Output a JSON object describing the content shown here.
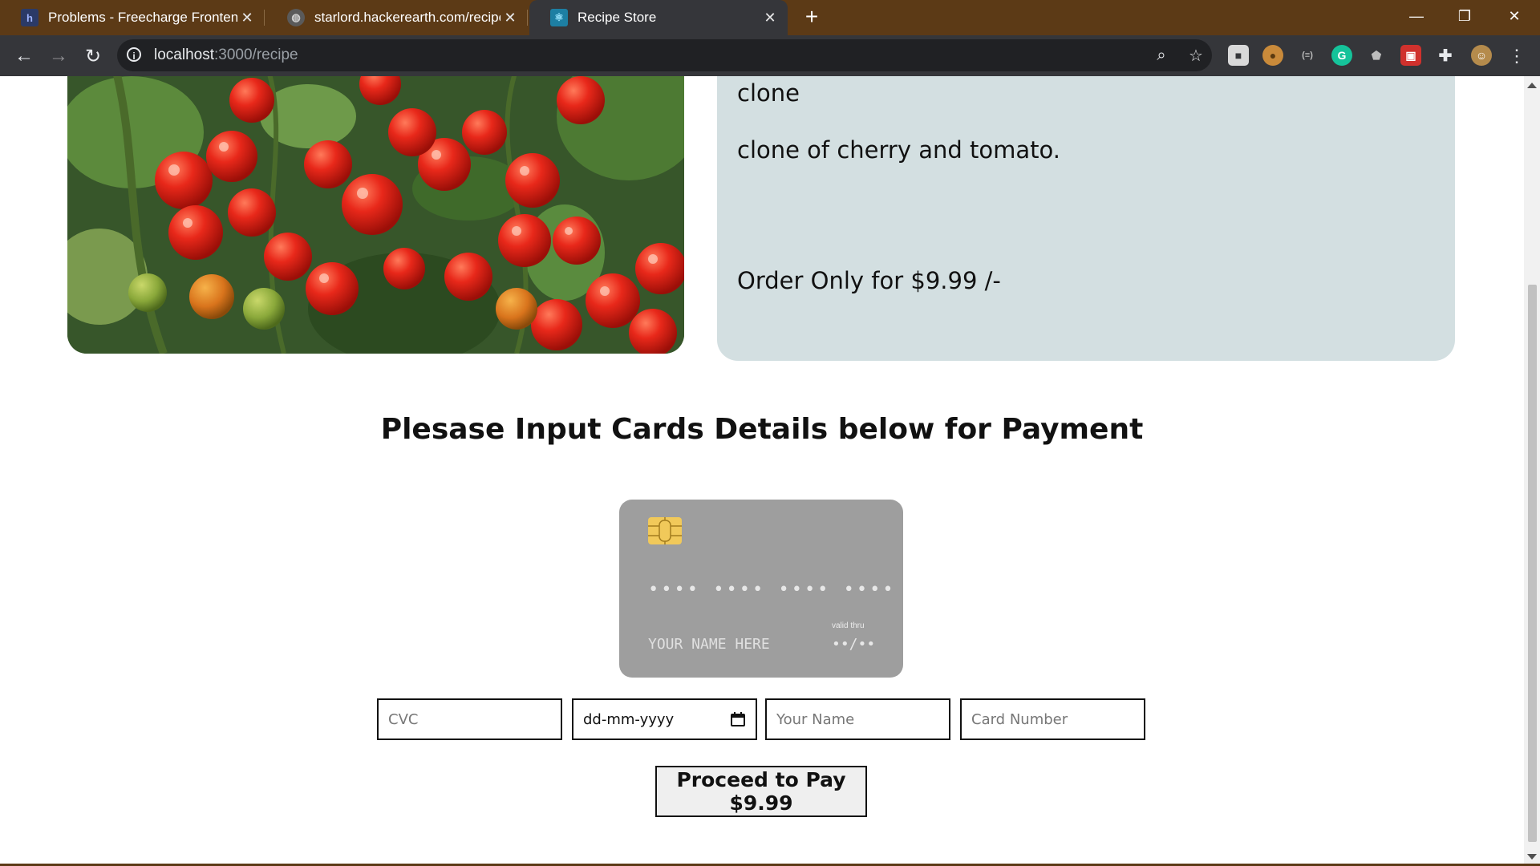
{
  "browser": {
    "tabs": [
      {
        "title": "Problems - Freecharge Frontend",
        "favicon": "hackerearth-icon"
      },
      {
        "title": "starlord.hackerearth.com/recipe",
        "favicon": "globe-icon"
      },
      {
        "title": "Recipe Store",
        "favicon": "react-icon"
      }
    ],
    "new_tab": "+",
    "url_host": "localhost",
    "url_path": ":3000/recipe"
  },
  "recipe": {
    "name": "clone",
    "description": "clone of cherry and tomato.",
    "price_text": "Order Only for $9.99 /-",
    "image": "cherry-tomatoes-photo"
  },
  "payment": {
    "heading": "Plesase Input Cards Details below for Payment",
    "card": {
      "number": "•••• •••• •••• ••••",
      "name": "YOUR NAME HERE",
      "valid_label": "valid thru",
      "expiry": "••/••"
    },
    "fields": {
      "cvc_placeholder": "CVC",
      "date_placeholder": "dd-mm-yyyy",
      "name_placeholder": "Your Name",
      "card_number_placeholder": "Card Number"
    },
    "button_label": "Proceed to Pay $9.99"
  },
  "colors": {
    "tabbar": "#5c3a16",
    "toolbar": "#35363a",
    "recipe_panel": "#d3dfe1",
    "card": "#9e9e9e"
  }
}
